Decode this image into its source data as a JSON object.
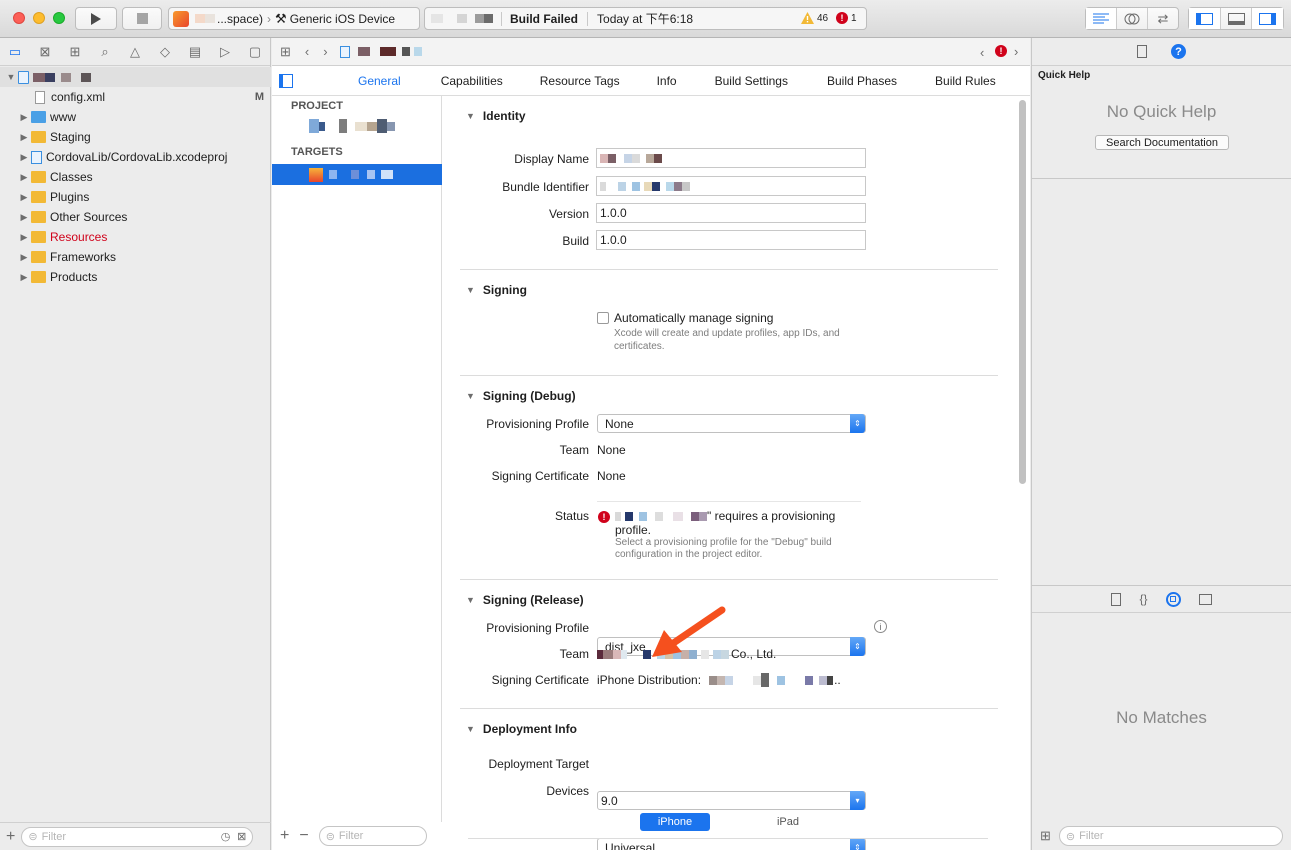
{
  "toolbar": {
    "scheme_label": "...space)",
    "device_label": "Generic iOS Device",
    "build_status": "Build Failed",
    "build_time": "Today at 下午6:18",
    "warnings_count": "46",
    "errors_count": "1"
  },
  "navigator": {
    "files": [
      {
        "name": "config.xml",
        "badge": "M",
        "red": false,
        "kind": "file"
      },
      {
        "name": "www",
        "badge": "",
        "red": false,
        "kind": "bluefolder"
      },
      {
        "name": "Staging",
        "badge": "",
        "red": false,
        "kind": "folder"
      },
      {
        "name": "CordovaLib/CordovaLib.xcodeproj",
        "badge": "",
        "red": false,
        "kind": "project"
      },
      {
        "name": "Classes",
        "badge": "",
        "red": false,
        "kind": "folder"
      },
      {
        "name": "Plugins",
        "badge": "",
        "red": false,
        "kind": "folder"
      },
      {
        "name": "Other Sources",
        "badge": "",
        "red": false,
        "kind": "folder"
      },
      {
        "name": "Resources",
        "badge": "",
        "red": true,
        "kind": "folder"
      },
      {
        "name": "Frameworks",
        "badge": "",
        "red": false,
        "kind": "folder"
      },
      {
        "name": "Products",
        "badge": "",
        "red": false,
        "kind": "folder"
      }
    ],
    "filter_placeholder": "Filter"
  },
  "editor": {
    "tabs": [
      "General",
      "Capabilities",
      "Resource Tags",
      "Info",
      "Build Settings",
      "Build Phases",
      "Build Rules"
    ],
    "project_header": "PROJECT",
    "targets_header": "TARGETS",
    "target_filter_placeholder": "Filter",
    "identity": {
      "title": "Identity",
      "display_name_label": "Display Name",
      "bundle_id_label": "Bundle Identifier",
      "version_label": "Version",
      "version_value": "1.0.0",
      "build_label": "Build",
      "build_value": "1.0.0"
    },
    "signing": {
      "title": "Signing",
      "auto_label": "Automatically manage signing",
      "auto_desc": "Xcode will create and update profiles, app IDs, and certificates."
    },
    "signing_debug": {
      "title": "Signing (Debug)",
      "profile_label": "Provisioning Profile",
      "profile_value": "None",
      "team_label": "Team",
      "team_value": "None",
      "cert_label": "Signing Certificate",
      "cert_value": "None",
      "status_label": "Status",
      "status_msg": "\" requires a provisioning profile.",
      "status_detail": "Select a provisioning profile for the \"Debug\" build configuration in the project editor."
    },
    "signing_release": {
      "title": "Signing (Release)",
      "profile_label": "Provisioning Profile",
      "profile_value": "dist_jxe",
      "team_label": "Team",
      "team_suffix": "Co., Ltd.",
      "cert_label": "Signing Certificate",
      "cert_value": "iPhone Distribution:"
    },
    "deployment": {
      "title": "Deployment Info",
      "target_label": "Deployment Target",
      "target_value": "9.0",
      "devices_label": "Devices",
      "devices_value": "Universal",
      "seg_iphone": "iPhone",
      "seg_ipad": "iPad"
    }
  },
  "inspector": {
    "quick_help_title": "Quick Help",
    "no_quick_help": "No Quick Help",
    "search_docs": "Search Documentation",
    "no_matches": "No Matches",
    "filter_placeholder": "Filter"
  },
  "colors": {
    "accent": "#1b74ee",
    "error": "#d0021b",
    "annotation_arrow": "#f5501e"
  }
}
